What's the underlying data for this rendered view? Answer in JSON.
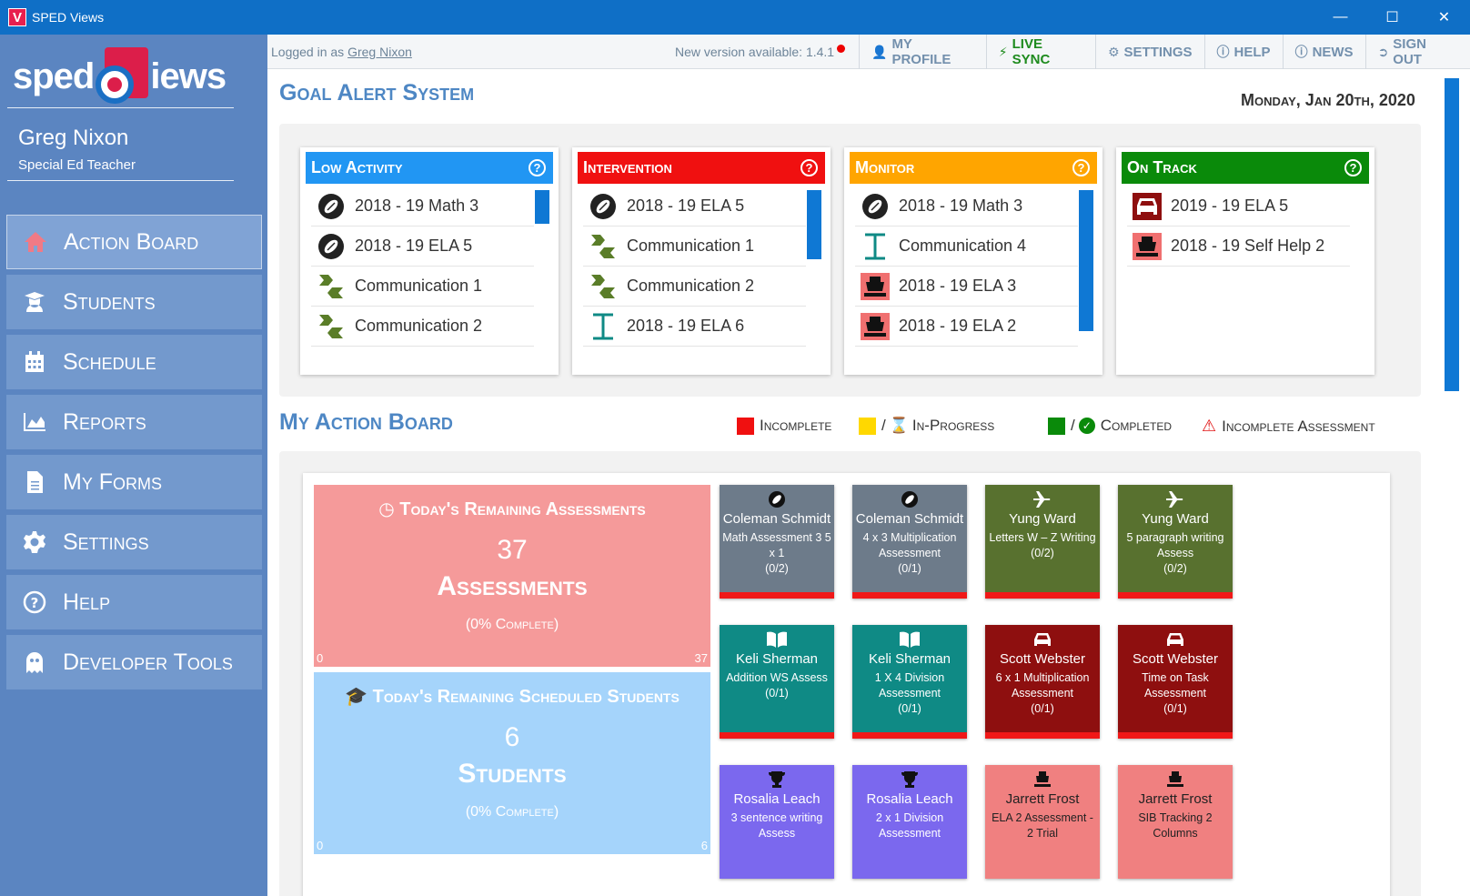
{
  "window": {
    "title": "SPED Views",
    "icon_letter": "V"
  },
  "logo": {
    "left": "sped",
    "right": "iews"
  },
  "user": {
    "name": "Greg Nixon",
    "role": "Special Ed Teacher"
  },
  "nav": [
    {
      "label": "Action Board",
      "icon": "home-icon",
      "active": true
    },
    {
      "label": "Students",
      "icon": "student-icon"
    },
    {
      "label": "Schedule",
      "icon": "calendar-icon"
    },
    {
      "label": "Reports",
      "icon": "chart-icon"
    },
    {
      "label": "My Forms",
      "icon": "file-icon"
    },
    {
      "label": "Settings",
      "icon": "gear-icon"
    },
    {
      "label": "Help",
      "icon": "help-icon"
    },
    {
      "label": "Developer Tools",
      "icon": "ghost-icon"
    }
  ],
  "header": {
    "logged_prefix": "Logged in as",
    "logged_user": "Greg Nixon",
    "new_version": "New version available: 1.4.1",
    "buttons": [
      "MY PROFILE",
      "LIVE SYNC",
      "SETTINGS",
      "HELP",
      "NEWS",
      "SIGN OUT"
    ]
  },
  "goal_alert": {
    "title": "Goal Alert System",
    "date": "Monday, Jan 20th, 2020",
    "cards": [
      {
        "title": "Low Activity",
        "color": "#2196f3",
        "rows": [
          "2018 - 19 Math 3",
          "2018 - 19 ELA 5",
          "Communication 1",
          "Communication 2"
        ]
      },
      {
        "title": "Intervention",
        "color": "#f01010",
        "rows": [
          "2018 - 19 ELA 5",
          "Communication 1",
          "Communication 2",
          "2018 - 19 ELA 6"
        ]
      },
      {
        "title": "Monitor",
        "color": "#ffa500",
        "rows": [
          "2018 - 19 Math 3",
          "Communication 4",
          "2018 - 19 ELA 3",
          "2018 - 19 ELA 2"
        ]
      },
      {
        "title": "On Track",
        "color": "#0a8a0a",
        "rows": [
          "2019 - 19 ELA 5",
          "2018 - 19 Self Help 2"
        ]
      }
    ]
  },
  "action_board": {
    "title": "My Action Board",
    "legend": {
      "incomplete": "Incomplete",
      "in_progress": "In-Progress",
      "completed": "Completed",
      "incomplete_assessment": "Incomplete Assessment"
    },
    "assessments": {
      "title": "Today's Remaining Assessments",
      "count": "37",
      "unit": "Assessments",
      "percent": "(0% Complete)",
      "min": "0",
      "max": "37",
      "color": "#f59a9a"
    },
    "students": {
      "title": "Today's Remaining Scheduled Students",
      "count": "6",
      "unit": "Students",
      "percent": "(0% Complete)",
      "min": "0",
      "max": "6",
      "color": "#a5d4fb"
    },
    "tiles": [
      {
        "name": "Coleman Schmidt",
        "desc": "Math Assessment 3 5 x 1",
        "count": "(0/2)",
        "color": "#6d7b8a",
        "icon": "football-icon"
      },
      {
        "name": "Coleman Schmidt",
        "desc": "4 x 3 Multiplication Assessment",
        "count": "(0/1)",
        "color": "#6d7b8a",
        "icon": "football-icon"
      },
      {
        "name": "Yung Ward",
        "desc": "Letters W – Z Writing",
        "count": "(0/2)",
        "color": "#58712f",
        "icon": "plane-icon"
      },
      {
        "name": "Yung Ward",
        "desc": "5 paragraph writing Assess",
        "count": "(0/2)",
        "color": "#58712f",
        "icon": "plane-icon"
      },
      {
        "name": "Keli Sherman",
        "desc": "Addition WS Assess",
        "count": "(0/1)",
        "color": "#0f8a85",
        "icon": "book-icon"
      },
      {
        "name": "Keli Sherman",
        "desc": "1 X 4 Division Assessment",
        "count": "(0/1)",
        "color": "#0f8a85",
        "icon": "book-icon"
      },
      {
        "name": "Scott Webster",
        "desc": "6 x 1 Multiplication Assessment",
        "count": "(0/1)",
        "color": "#8e0f0f",
        "icon": "car-icon"
      },
      {
        "name": "Scott Webster",
        "desc": "Time on Task Assessment",
        "count": "(0/1)",
        "color": "#8e0f0f",
        "icon": "car-icon"
      },
      {
        "name": "Rosalia Leach",
        "desc": "3 sentence writing Assess",
        "count": "",
        "color": "#7b68ee",
        "icon": "trophy-icon"
      },
      {
        "name": "Rosalia Leach",
        "desc": "2 x 1 Division Assessment",
        "count": "",
        "color": "#7b68ee",
        "icon": "trophy-icon"
      },
      {
        "name": "Jarrett Frost",
        "desc": "ELA 2 Assessment - 2 Trial",
        "count": "",
        "color": "#f08080",
        "icon": "ship-icon"
      },
      {
        "name": "Jarrett Frost",
        "desc": "SIB Tracking 2 Columns",
        "count": "",
        "color": "#f08080",
        "icon": "ship-icon"
      }
    ]
  }
}
